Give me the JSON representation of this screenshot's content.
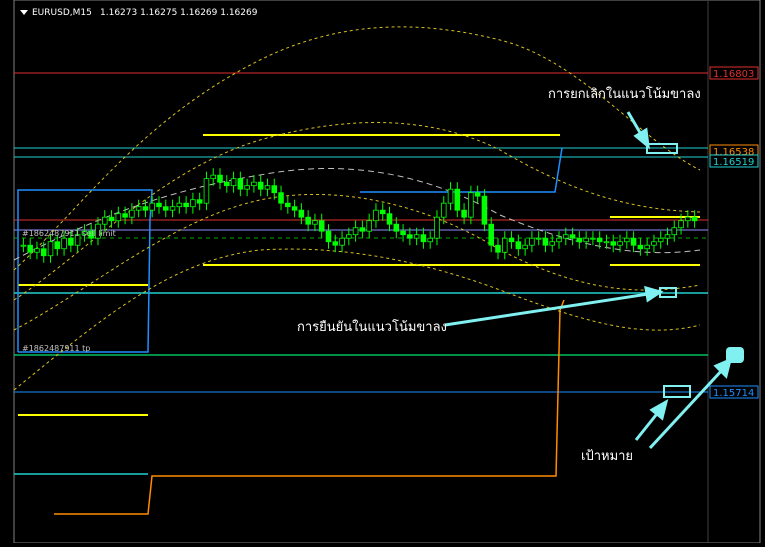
{
  "header": {
    "symbol": "EURUSD,M15",
    "ohlc": "1.16273 1.16275 1.16269 1.16269"
  },
  "price_labels": [
    {
      "value": "1.16803",
      "color": "#e03030"
    },
    {
      "value": "1.16538",
      "color": "#ff8c00"
    },
    {
      "value": "1.16519",
      "color": "#20d0d0"
    },
    {
      "value": "1.15714",
      "color": "#1e90ff"
    }
  ],
  "annotations": {
    "bear_cancel": "การยกเลิกในแนวโน้มขาลง",
    "bear_confirm": "การยืนยันในแนวโน้มขาลง",
    "target": "เป้าหมาย"
  },
  "order_labels": {
    "order_1": "#1862487911 sell limit",
    "order_2": "#1862487911 tp"
  },
  "colors": {
    "background": "#000000",
    "candle_body": "#00ff00",
    "resistance_line": "#e03030",
    "support_line": "#20d0d0",
    "target_line": "#1e90ff",
    "zone_line": "#ffff00",
    "channel_line": "#1e90ff",
    "orange_line": "#ff8c00",
    "callout": "#80f0f0"
  },
  "chart_data": {
    "type": "candlestick",
    "symbol": "EURUSD",
    "timeframe": "M15",
    "ylim": [
      1.1545,
      1.17
    ],
    "last_price": 1.16269,
    "close_series": [
      1.163,
      1.1628,
      1.1629,
      1.1627,
      1.1631,
      1.1629,
      1.1632,
      1.163,
      1.1633,
      1.1634,
      1.1632,
      1.1636,
      1.1638,
      1.1637,
      1.1639,
      1.1638,
      1.164,
      1.1641,
      1.164,
      1.1642,
      1.1641,
      1.164,
      1.1641,
      1.1642,
      1.1641,
      1.1643,
      1.1642,
      1.1649,
      1.165,
      1.1648,
      1.1647,
      1.1649,
      1.1646,
      1.1647,
      1.1648,
      1.1646,
      1.1647,
      1.1645,
      1.1642,
      1.1641,
      1.164,
      1.1638,
      1.1636,
      1.1637,
      1.1634,
      1.1631,
      1.163,
      1.1632,
      1.1633,
      1.1635,
      1.1634,
      1.1637,
      1.164,
      1.1639,
      1.1636,
      1.1634,
      1.1633,
      1.1632,
      1.1633,
      1.1631,
      1.1632,
      1.1638,
      1.1642,
      1.1646,
      1.164,
      1.1638,
      1.1645,
      1.1644,
      1.1636,
      1.163,
      1.1628,
      1.1632,
      1.1631,
      1.1629,
      1.163,
      1.1632,
      1.1632,
      1.163,
      1.1631,
      1.1632,
      1.1633,
      1.1632,
      1.1631,
      1.1632,
      1.1632,
      1.1631,
      1.1631,
      1.163,
      1.1631,
      1.1632,
      1.163,
      1.1629,
      1.163,
      1.1631,
      1.1632,
      1.1633,
      1.1635,
      1.1637,
      1.1638,
      1.1637
    ]
  }
}
